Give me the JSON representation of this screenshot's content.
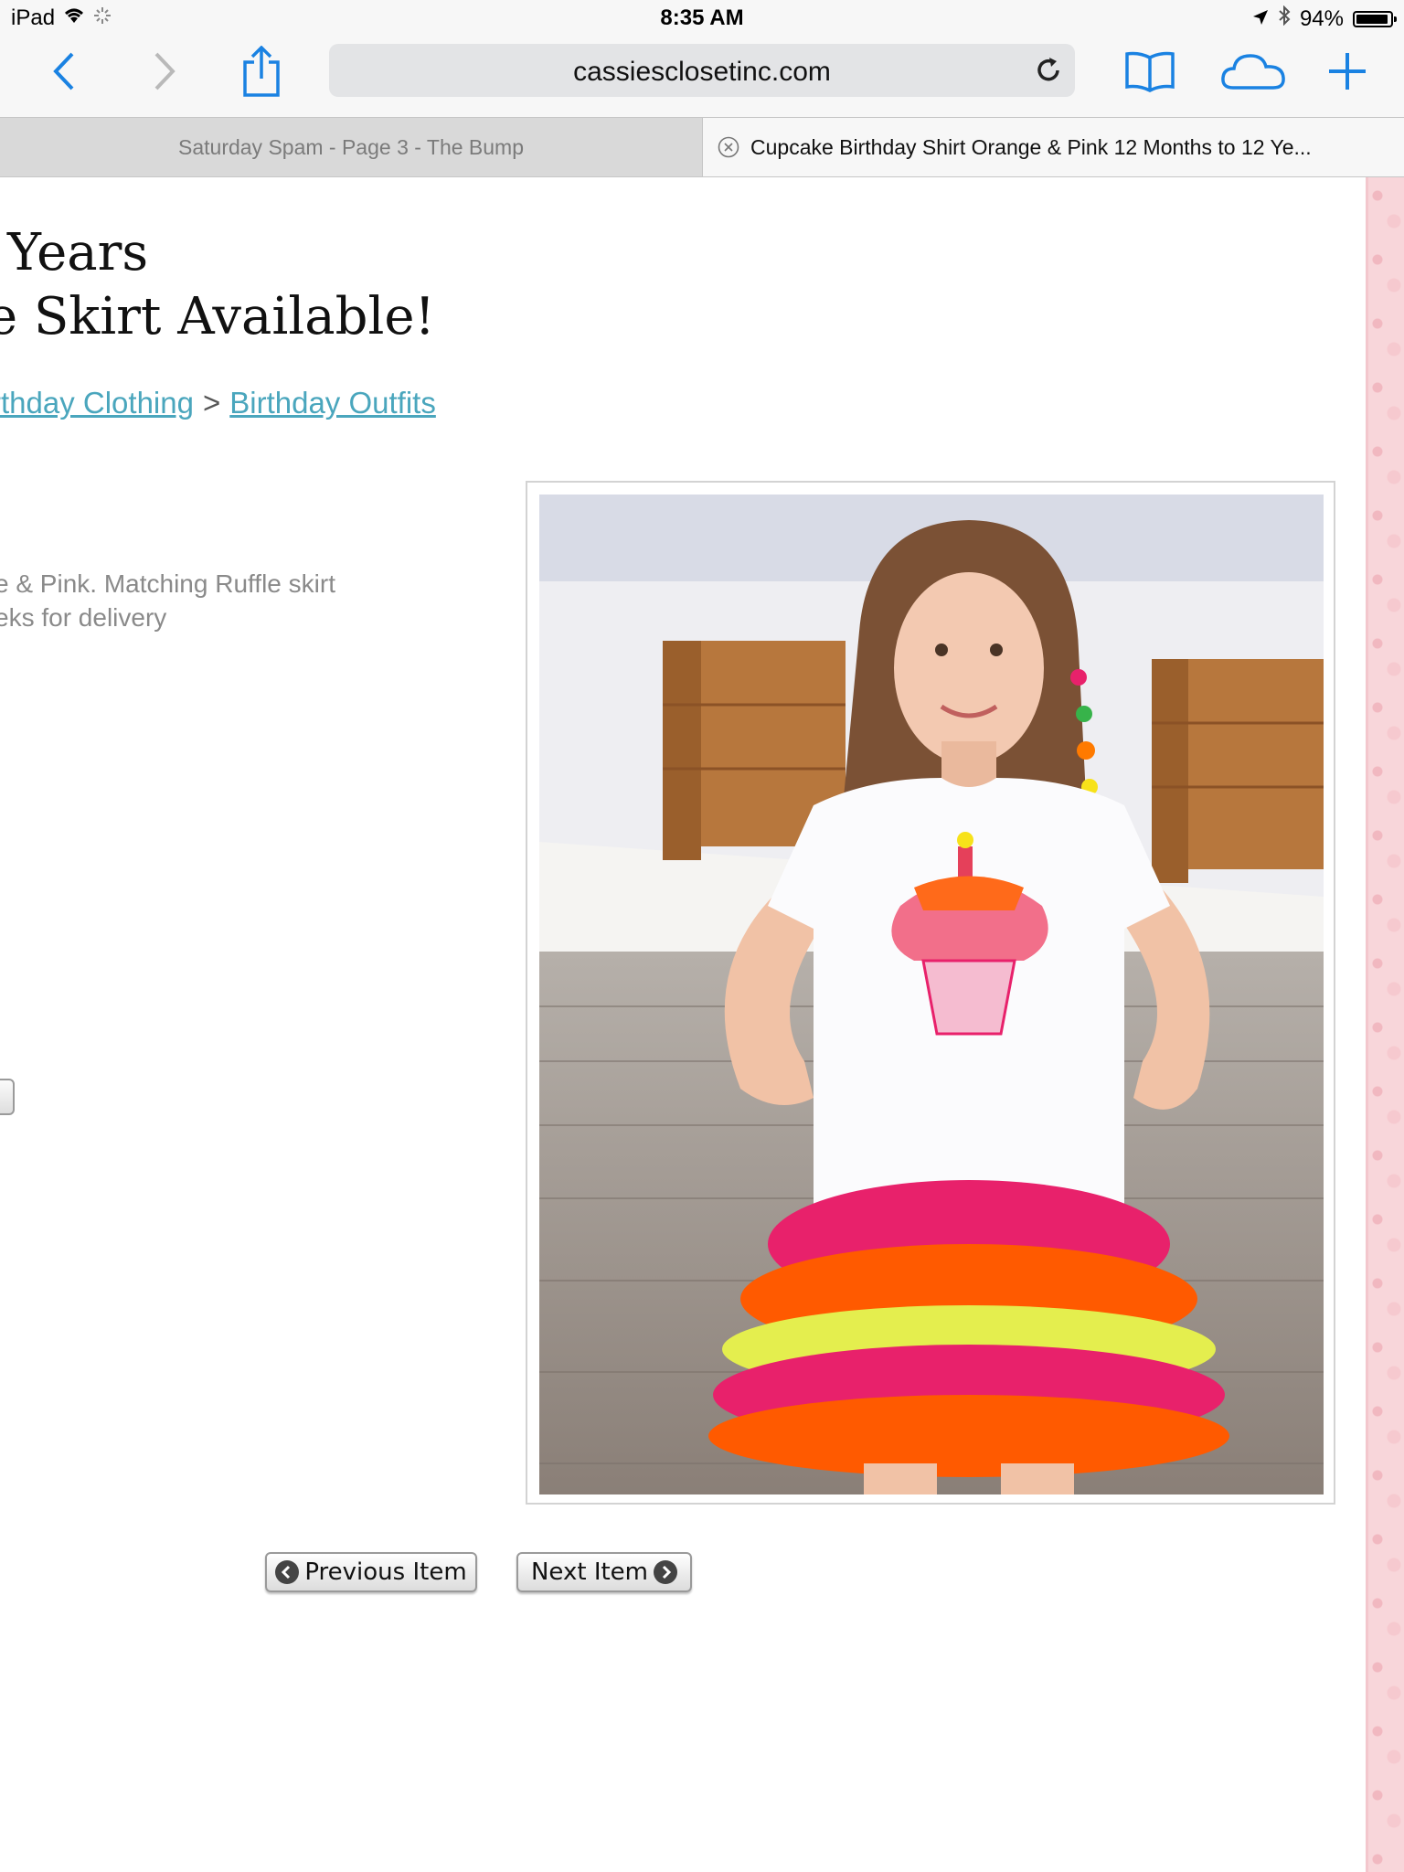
{
  "status_bar": {
    "device": "iPad",
    "time": "8:35 AM",
    "battery": "94%",
    "battery_level": 0.94
  },
  "browser": {
    "url": "cassiesclosetinc.com",
    "tabs": [
      {
        "label": "Saturday Spam - Page 3 - The Bump",
        "active": false
      },
      {
        "label": "Cupcake Birthday Shirt Orange & Pink 12 Months to 12 Ye...",
        "active": true
      }
    ]
  },
  "product": {
    "title_line1": "Years",
    "title_line2": "e Skirt Available!",
    "breadcrumb": {
      "link1": "rthday Clothing",
      "separator": ">",
      "link2": "Birthday Outfits"
    },
    "description_line1": "e & Pink. Matching Ruffle skirt",
    "description_line2": "eks for delivery",
    "image_alt": "Girl wearing white cupcake birthday shirt with orange, pink and yellow ruffle skirt"
  },
  "navigation": {
    "previous_label": "Previous Item",
    "next_label": "Next Item"
  },
  "colors": {
    "link": "#4aa6bd",
    "browser_accent": "#1a82e2",
    "side_background": "#f8d6da"
  }
}
